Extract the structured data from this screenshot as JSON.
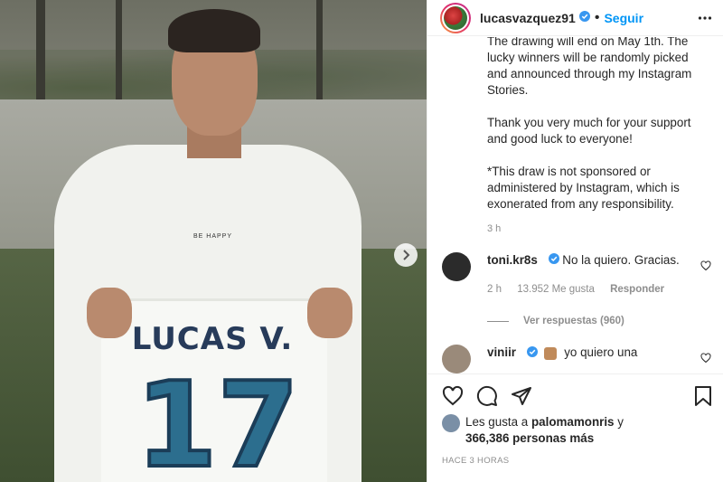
{
  "post": {
    "shirt_name": "LUCAS V.",
    "shirt_number": "17",
    "shirt_small_print": "BE HAPPY"
  },
  "header": {
    "username": "lucasvazquez91",
    "separator": "•",
    "follow_label": "Seguir"
  },
  "caption": {
    "paragraphs": [
      "The drawing will end on May 1th. The lucky winners will be randomly picked and announced through my Instagram Stories.",
      "Thank you very much for your support and good luck to everyone!",
      "*This draw is not sponsored or administered by Instagram, which is exonerated from any responsibility."
    ],
    "time": "3 h"
  },
  "comments": [
    {
      "username": "toni.kr8s",
      "text": "No la quiero. Gracias.",
      "time": "2 h",
      "likes": "13.952 Me gusta",
      "reply_label": "Responder",
      "view_replies": "Ver respuestas (960)"
    },
    {
      "username": "viniir",
      "text": "yo quiero una"
    }
  ],
  "likes": {
    "prefix": "Les gusta a",
    "user": "palomamonris",
    "connector": "y",
    "count": "366,386 personas más"
  },
  "timestamp": "HACE 3 HORAS",
  "icons": {
    "verified": "verified-badge-icon",
    "more": "more-options-icon",
    "next": "chevron-right-icon",
    "like": "heart-icon",
    "comment": "comment-icon",
    "share": "paper-plane-icon",
    "save": "bookmark-icon"
  },
  "colors": {
    "link": "#0095f6",
    "verified": "#3897f0",
    "muted": "#8e8e8e",
    "text": "#262626"
  }
}
